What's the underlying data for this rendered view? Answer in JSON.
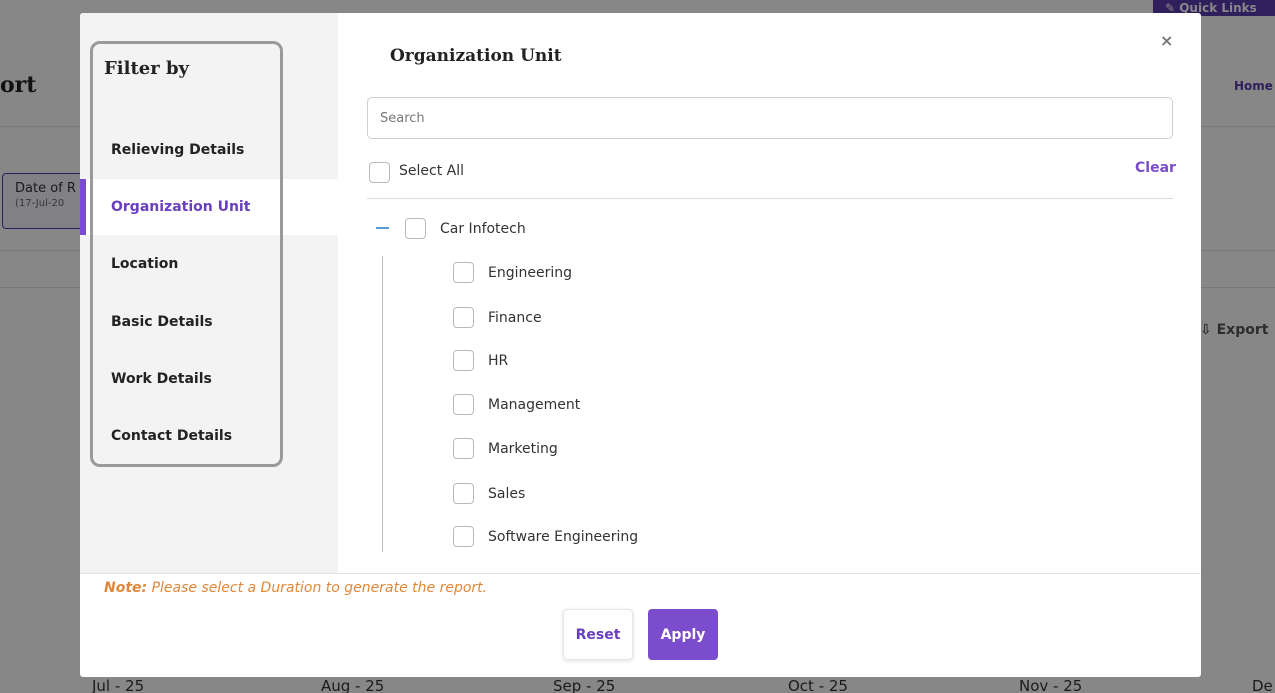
{
  "background": {
    "quick_links": "✎ Quick Links",
    "page_title": "ort",
    "home_link": "Home",
    "date_chip": {
      "label": "Date of R",
      "range": "(17-Jul-20"
    },
    "export_label": "⇩ Export",
    "months": [
      "Jul - 25",
      "Aug - 25",
      "Sep - 25",
      "Oct - 25",
      "Nov - 25",
      "De"
    ]
  },
  "sidebar": {
    "title": "Filter by",
    "items": [
      {
        "label": "Relieving Details",
        "active": false
      },
      {
        "label": "Organization Unit",
        "active": true
      },
      {
        "label": "Location",
        "active": false
      },
      {
        "label": "Basic Details",
        "active": false
      },
      {
        "label": "Work Details",
        "active": false
      },
      {
        "label": "Contact Details",
        "active": false
      }
    ]
  },
  "panel": {
    "title": "Organization Unit",
    "close_icon": "×",
    "search_placeholder": "Search",
    "select_all_label": "Select All",
    "clear_label": "Clear",
    "tree": {
      "root": "Car Infotech",
      "children": [
        "Engineering",
        "Finance",
        "HR",
        "Management",
        "Marketing",
        "Sales",
        "Software Engineering"
      ]
    }
  },
  "footer": {
    "note_prefix": "Note:",
    "note_text": " Please select a Duration to generate the report.",
    "reset_label": "Reset",
    "apply_label": "Apply"
  },
  "colors": {
    "accent": "#7b4ccc",
    "note": "#e0883a",
    "tree_toggle": "#5b9bd5"
  }
}
